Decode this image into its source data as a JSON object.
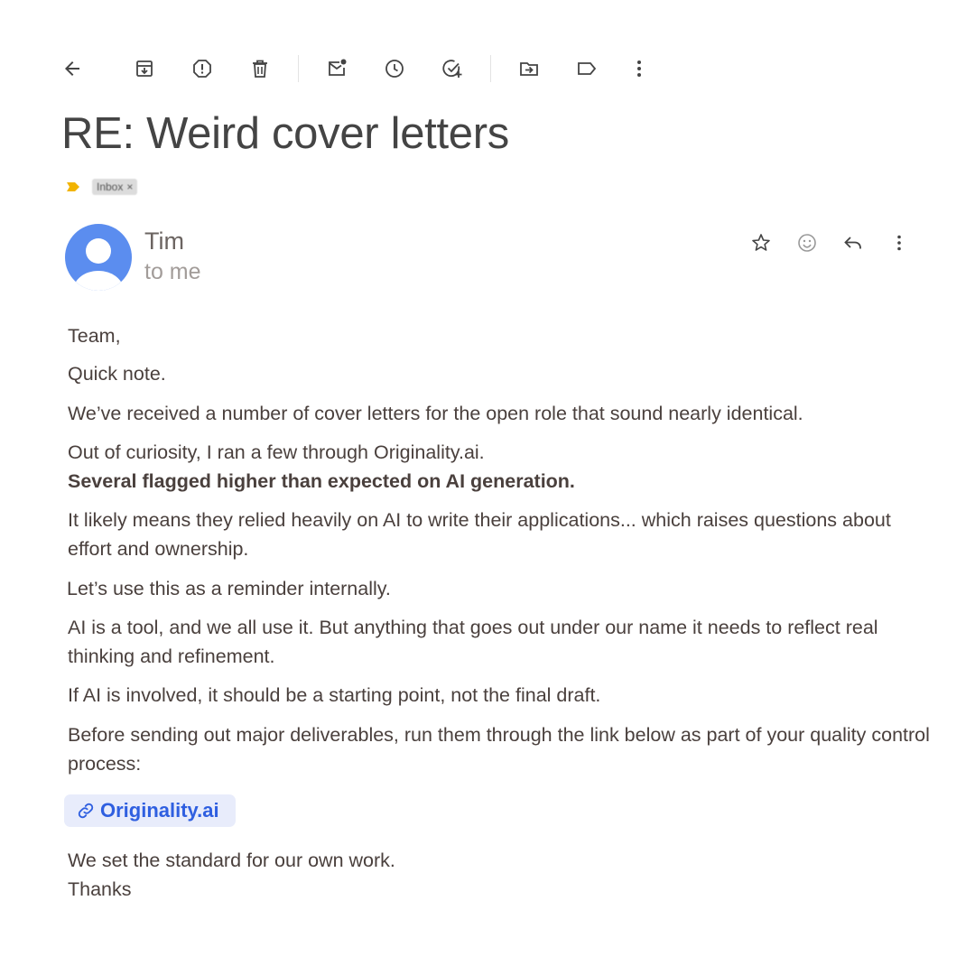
{
  "toolbar": {
    "icons": [
      "back-arrow-icon",
      "archive-icon",
      "report-spam-icon",
      "delete-icon",
      "mark-unread-icon",
      "snooze-icon",
      "add-task-icon",
      "move-to-icon",
      "label-icon",
      "more-vert-icon"
    ]
  },
  "email": {
    "subject": "RE: Weird cover letters",
    "label": "Inbox",
    "label_close": "×",
    "sender": "Tim",
    "recipient": "to me"
  },
  "body": {
    "p1": "Team,",
    "p2": "Quick note.",
    "p3": "We’ve received a number of cover letters for the open role that sound nearly identical.",
    "p4a": "Out of curiosity, I ran a few through Originality.ai.",
    "p4b": "Several flagged higher than expected on AI generation.",
    "p5": "It likely means they relied heavily on AI to write their applications... which raises questions about effort and ownership.",
    "p6": "Let’s use this as a reminder internally.",
    "p7": "AI is a tool, and we all use it. But anything that goes out under our name it needs to reflect real thinking and refinement.",
    "p8": "If AI is involved, it should be a starting point, not the final draft.",
    "p9": "Before sending out major deliverables, run them through the link below as part of your quality control process:",
    "link_text": "Originality.ai",
    "p10": "We set the standard for our own work.",
    "p11": "Thanks"
  },
  "colors": {
    "accent_link": "#2f5fe0",
    "link_bg": "#e8ecfb",
    "avatar": "#5b8def",
    "importance_marker": "#f2b400"
  }
}
